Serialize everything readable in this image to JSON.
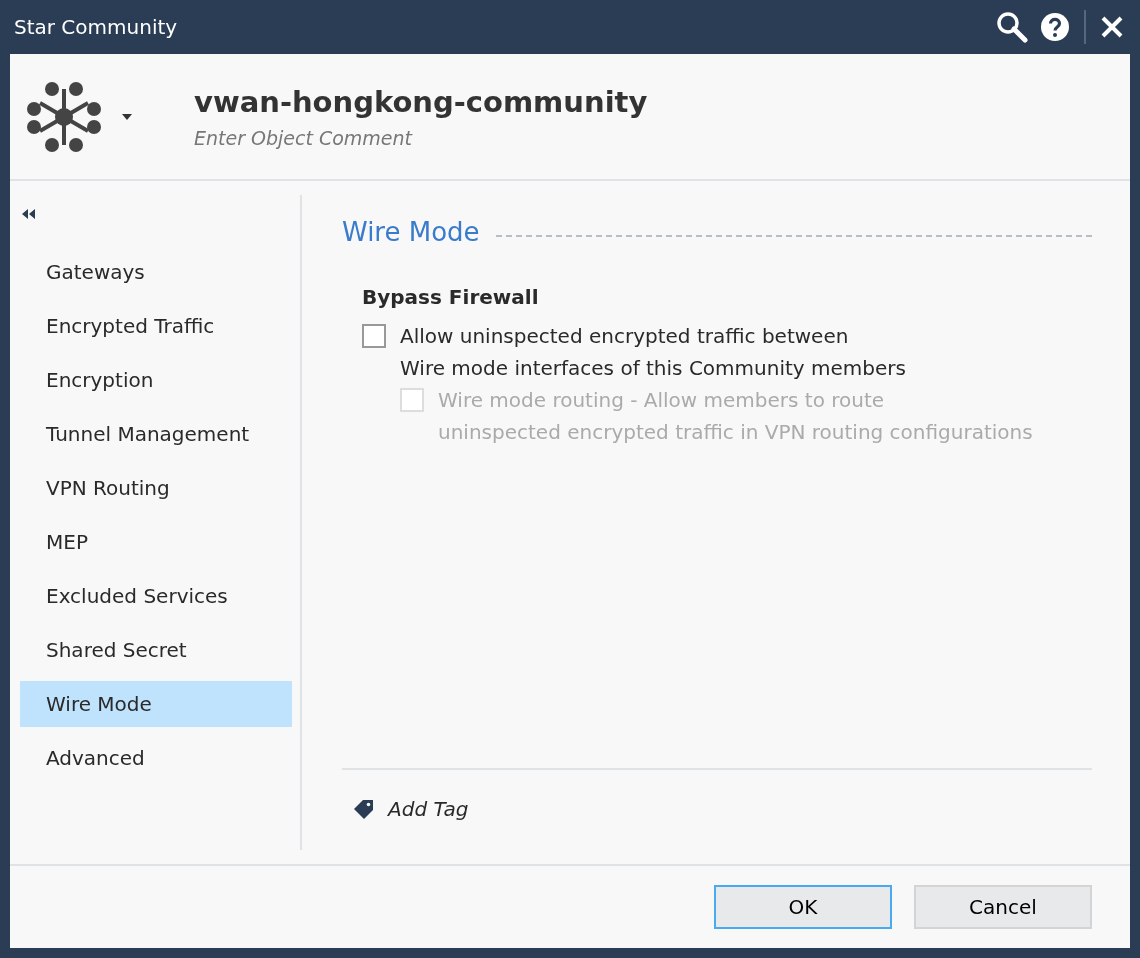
{
  "window": {
    "title": "Star Community"
  },
  "header": {
    "name": "vwan-hongkong-community",
    "comment_placeholder": "Enter Object Comment"
  },
  "sidebar": {
    "items": [
      {
        "label": "Gateways",
        "selected": false
      },
      {
        "label": "Encrypted Traffic",
        "selected": false
      },
      {
        "label": "Encryption",
        "selected": false
      },
      {
        "label": "Tunnel Management",
        "selected": false
      },
      {
        "label": "VPN Routing",
        "selected": false
      },
      {
        "label": "MEP",
        "selected": false
      },
      {
        "label": "Excluded Services",
        "selected": false
      },
      {
        "label": "Shared Secret",
        "selected": false
      },
      {
        "label": "Wire Mode",
        "selected": true
      },
      {
        "label": "Advanced",
        "selected": false
      }
    ]
  },
  "section": {
    "title": "Wire Mode",
    "group": "Bypass Firewall",
    "options": [
      {
        "lines": [
          "Allow uninspected encrypted traffic between",
          "Wire mode interfaces of this Community members"
        ],
        "checked": false,
        "disabled": false,
        "children": [
          {
            "lines": [
              "Wire mode routing - Allow members to route",
              "uninspected encrypted traffic in VPN routing configurations"
            ],
            "checked": false,
            "disabled": true
          }
        ]
      }
    ]
  },
  "add_tag": "Add Tag",
  "buttons": [
    {
      "label": "OK",
      "default": true
    },
    {
      "label": "Cancel",
      "default": false
    }
  ]
}
